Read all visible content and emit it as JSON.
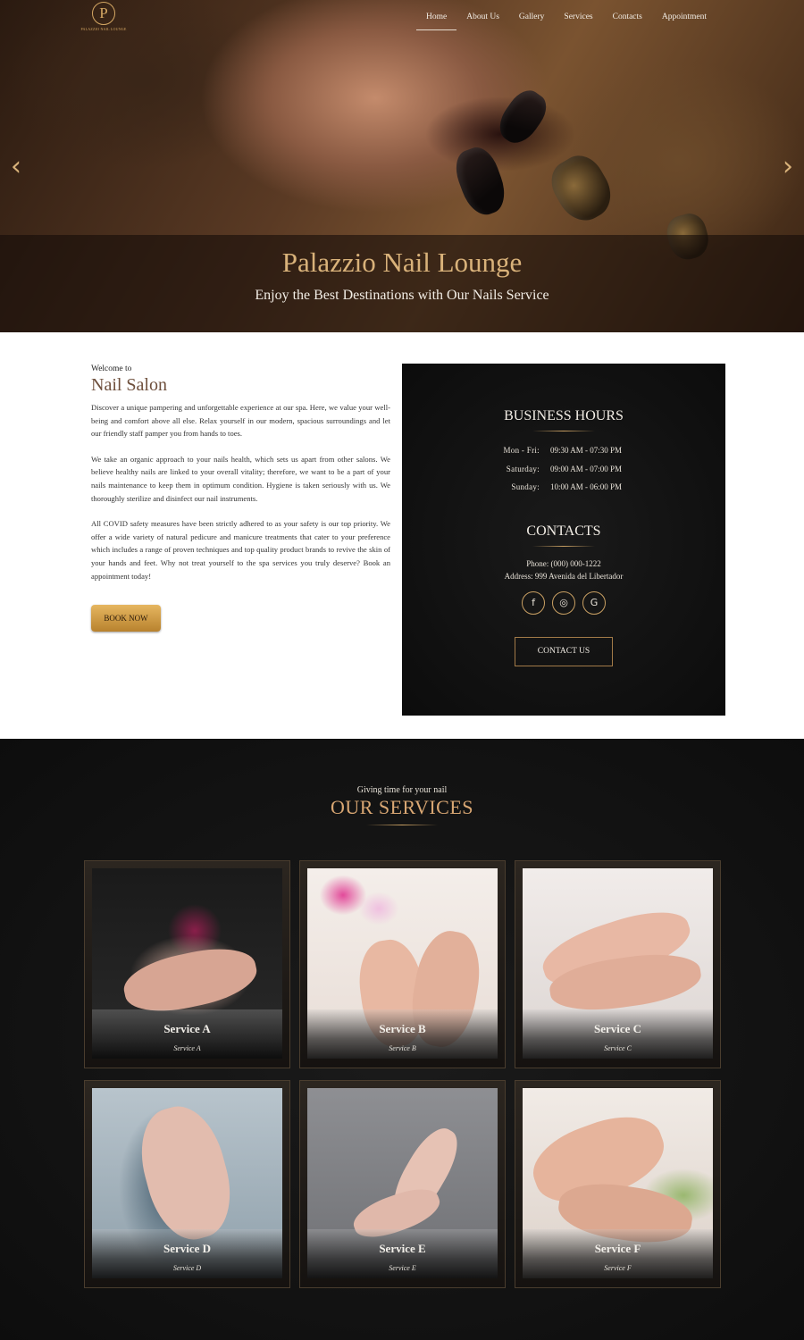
{
  "brand": {
    "logo_letter": "P",
    "logo_text": "PALAZZIO NAIL LOUNGE"
  },
  "nav": {
    "items": [
      "Home",
      "About Us",
      "Gallery",
      "Services",
      "Contacts",
      "Appointment"
    ],
    "active": "Home"
  },
  "hero": {
    "title": "Palazzio Nail Lounge",
    "subtitle": "Enjoy the Best Destinations with Our Nails Service",
    "prev_glyph": "‹",
    "next_glyph": "›"
  },
  "intro": {
    "welcome": "Welcome to",
    "title": "Nail Salon",
    "paragraphs": [
      "Discover a unique pampering and unforgettable experience at our spa. Here, we value your well-being and comfort above all else. Relax yourself in our modern, spacious surroundings and let our friendly staff pamper you from hands to toes.",
      "We take an organic approach to your nails health, which sets us apart from other salons. We believe healthy nails are linked to your overall vitality; therefore, we want to be a part of your nails maintenance to keep them in optimum condition. Hygiene is taken seriously with us. We thoroughly sterilize and disinfect our nail instruments.",
      "All COVID safety measures have been strictly adhered to as your safety is our top priority. We offer a wide variety of natural pedicure and manicure treatments that cater to your preference which includes a range of proven techniques and top quality product brands to revive the skin of your hands and feet. Why not treat yourself to the spa services you truly deserve? Book an appointment today!"
    ],
    "book_label": "BOOK NOW"
  },
  "info": {
    "hours_heading": "BUSINESS HOURS",
    "hours": [
      {
        "day": "Mon - Fri:",
        "time": "09:30 AM - 07:30 PM"
      },
      {
        "day": "Saturday:",
        "time": "09:00 AM - 07:00 PM"
      },
      {
        "day": "Sunday:",
        "time": "10:00 AM - 06:00 PM"
      }
    ],
    "contacts_heading": "CONTACTS",
    "phone": "Phone: (000) 000-1222",
    "address": "Address: 999 Avenida del Libertador",
    "socials": {
      "facebook": "f",
      "instagram": "◎",
      "google": "G"
    },
    "contact_label": "CONTACT US"
  },
  "services": {
    "eyebrow": "Giving time for your nail",
    "title": "OUR SERVICES",
    "cards": [
      {
        "title": "Service A",
        "sub": "Service A"
      },
      {
        "title": "Service B",
        "sub": "Service B"
      },
      {
        "title": "Service C",
        "sub": "Service C"
      },
      {
        "title": "Service D",
        "sub": "Service D"
      },
      {
        "title": "Service E",
        "sub": "Service E"
      },
      {
        "title": "Service F",
        "sub": "Service F"
      }
    ]
  },
  "colors": {
    "gold": "#d9b27a",
    "brown_title": "#6e4f3c",
    "dark_panel": "#0c0c0c"
  }
}
